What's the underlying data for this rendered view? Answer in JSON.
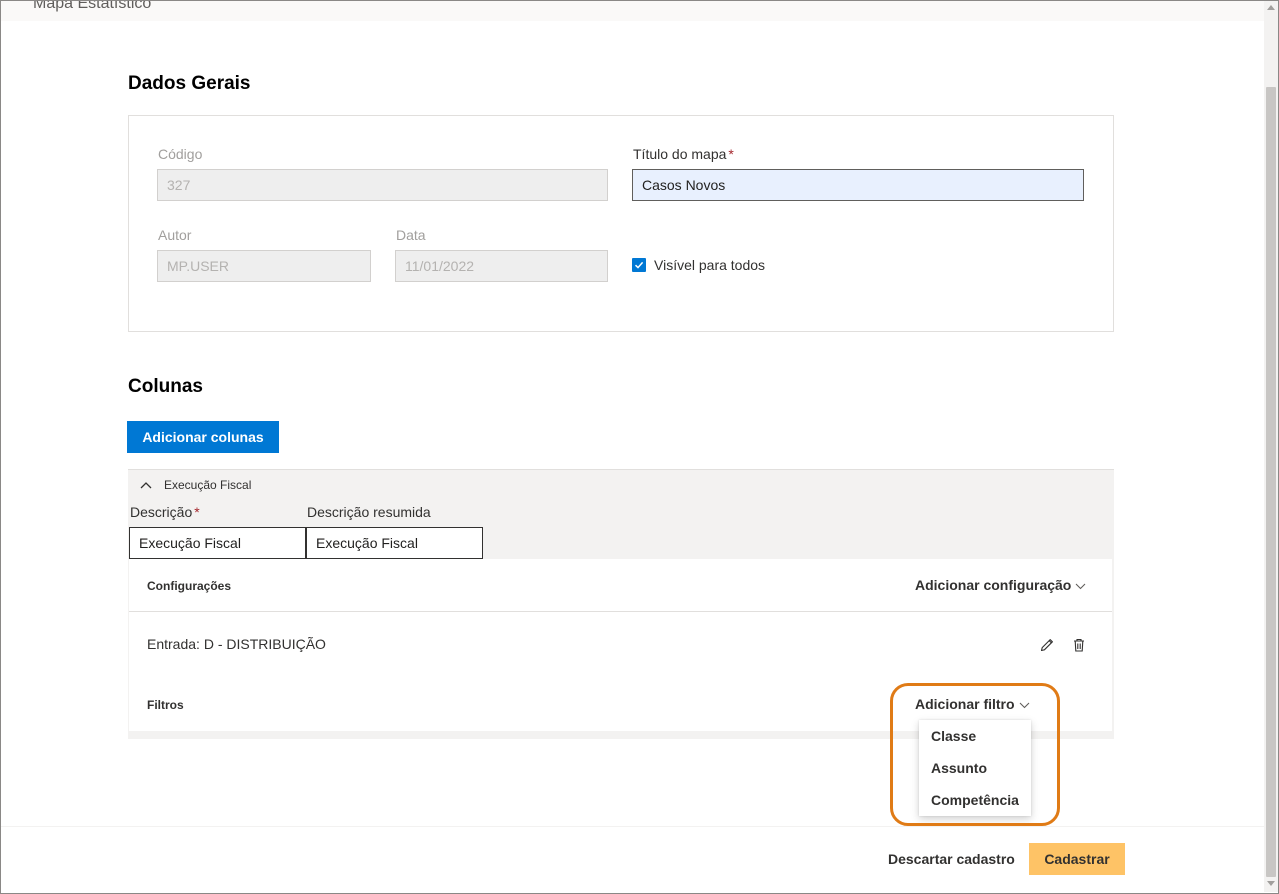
{
  "header": {
    "breadcrumb": "Mapa Estatístico"
  },
  "general": {
    "title": "Dados Gerais",
    "codigo": {
      "label": "Código",
      "value": "327"
    },
    "titulo": {
      "label": "Título do mapa",
      "required": "*",
      "value": "Casos Novos"
    },
    "autor": {
      "label": "Autor",
      "value": "MP.USER"
    },
    "data": {
      "label": "Data",
      "value": "11/01/2022"
    },
    "visivel": {
      "label": "Visível para todos",
      "checked": true
    }
  },
  "columns": {
    "title": "Colunas",
    "add_button": "Adicionar colunas",
    "item": {
      "header": "Execução Fiscal",
      "descricao_label": "Descrição",
      "required": "*",
      "descricao_value": "Execução Fiscal",
      "resumida_label": "Descrição resumida",
      "resumida_value": "Execução Fiscal",
      "configuracoes_label": "Configurações",
      "add_config": "Adicionar configuração",
      "entrada": "Entrada: D - DISTRIBUIÇÃO",
      "filtros_label": "Filtros",
      "add_filtro": "Adicionar filtro",
      "filter_options": [
        "Classe",
        "Assunto",
        "Competência"
      ]
    }
  },
  "footer": {
    "discard": "Descartar cadastro",
    "submit": "Cadastrar"
  },
  "colors": {
    "primary": "#0078d4",
    "submit": "#fec366",
    "highlight": "#e07b16",
    "required": "#a4262c"
  }
}
